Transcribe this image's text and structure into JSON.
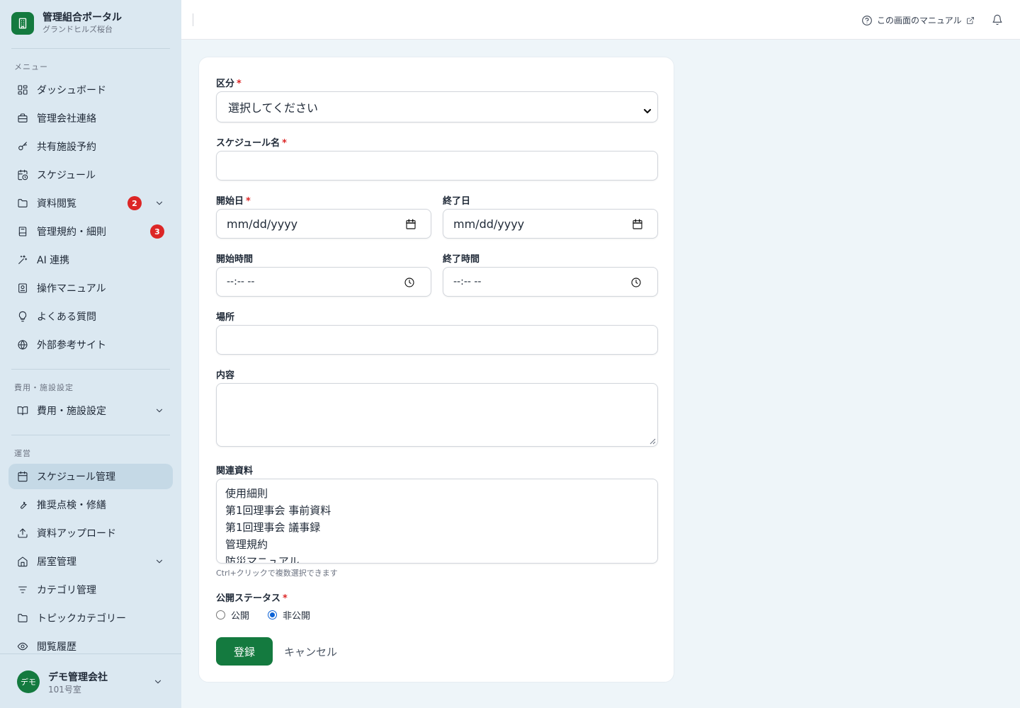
{
  "brand": {
    "title": "管理組合ポータル",
    "subtitle": "グランドヒルズ桜台"
  },
  "sidebar": {
    "sections": {
      "menu": "メニュー",
      "fees": "費用・施設設定",
      "ops": "運営"
    },
    "menu_items": [
      {
        "label": "ダッシュボード",
        "icon": "dashboard-icon"
      },
      {
        "label": "管理会社連絡",
        "icon": "briefcase-icon"
      },
      {
        "label": "共有施設予約",
        "icon": "key-icon"
      },
      {
        "label": "スケジュール",
        "icon": "calendar-clock-icon"
      },
      {
        "label": "資料閲覧",
        "icon": "folder-icon",
        "badge": "2"
      },
      {
        "label": "管理規約・細則",
        "icon": "book-icon",
        "badge": "3"
      },
      {
        "label": "AI 連携",
        "icon": "sparkle-icon"
      },
      {
        "label": "操作マニュアル",
        "icon": "manual-icon"
      },
      {
        "label": "よくある質問",
        "icon": "lightbulb-icon"
      },
      {
        "label": "外部参考サイト",
        "icon": "globe-icon"
      }
    ],
    "fees_items": [
      {
        "label": "費用・施設設定",
        "icon": "open-book-icon"
      }
    ],
    "ops_items": [
      {
        "label": "スケジュール管理",
        "icon": "calendar-icon"
      },
      {
        "label": "推奨点検・修繕",
        "icon": "wrench-icon"
      },
      {
        "label": "資料アップロード",
        "icon": "upload-icon"
      },
      {
        "label": "居室管理",
        "icon": "home-icon"
      },
      {
        "label": "カテゴリ管理",
        "icon": "filter-icon"
      },
      {
        "label": "トピックカテゴリー",
        "icon": "folder-icon"
      },
      {
        "label": "閲覧履歴",
        "icon": "eye-icon"
      }
    ]
  },
  "user": {
    "avatar": "デモ",
    "name": "デモ管理会社",
    "room": "101号室"
  },
  "header": {
    "manual_link": "この画面のマニュアル"
  },
  "form": {
    "category": {
      "label": "区分",
      "value": "選択してください"
    },
    "name": {
      "label": "スケジュール名",
      "value": ""
    },
    "start_date": {
      "label": "開始日",
      "placeholder": "mm/dd/yyyy"
    },
    "end_date": {
      "label": "終了日",
      "placeholder": "mm/dd/yyyy"
    },
    "start_time": {
      "label": "開始時間",
      "placeholder": "--:-- --"
    },
    "end_time": {
      "label": "終了時間",
      "placeholder": "--:-- --"
    },
    "place": {
      "label": "場所",
      "value": ""
    },
    "content": {
      "label": "内容",
      "value": ""
    },
    "related": {
      "label": "関連資料",
      "options": [
        "使用細則",
        "第1回理事会 事前資料",
        "第1回理事会 議事録",
        "管理規約",
        "防災マニュアル"
      ],
      "hint": "Ctrl+クリックで複数選択できます"
    },
    "status": {
      "label": "公開ステータス",
      "options": [
        "公開",
        "非公開"
      ],
      "selected": "非公開"
    },
    "submit_label": "登録",
    "cancel_label": "キャンセル"
  },
  "colors": {
    "brand_green": "#147a3f",
    "badge_red": "#dc2626",
    "required_red": "#dc2626"
  }
}
